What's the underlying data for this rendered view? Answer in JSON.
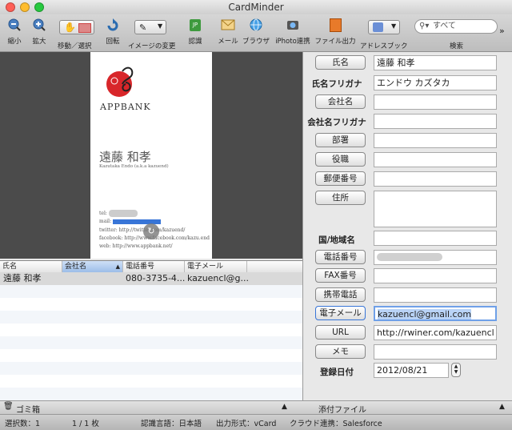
{
  "window": {
    "title": "CardMinder"
  },
  "toolbar": {
    "shrink": "縮小",
    "enlarge": "拡大",
    "move_select": "移動／選択",
    "rotate": "回転",
    "image_change": "イメージの変更",
    "recognize": "認識",
    "mail": "メール",
    "browser": "ブラウザ",
    "iphoto": "iPhoto連携",
    "file_output": "ファイル出力",
    "address_book": "アドレスブック",
    "search_label": "検索",
    "search_placeholder": "すべて"
  },
  "card": {
    "brand": "APPBANK",
    "name": "遠藤 和孝",
    "romaji": "Kazutaka Endo (a.k.a kazuend)",
    "tel_label": "tel:",
    "mail_label": "mail:",
    "twitter": "twitter: http://twitter.com/kazuend/",
    "facebook": "facebook: http://www.facebook.com/kazu.end",
    "web": "web: http://www.appbank.net/"
  },
  "list": {
    "columns": [
      "氏名",
      "会社名",
      "電話番号",
      "電子メール"
    ],
    "rows": [
      {
        "name": "遠藤 和孝",
        "company": "",
        "phone": "080-3735-4...",
        "email": "kazuencl@g..."
      }
    ]
  },
  "bottom": {
    "trash": "ゴミ箱",
    "attachments": "添付ファイル"
  },
  "status": {
    "selection": "選択数：1",
    "page": "1 / 1 枚",
    "language": "認識言語：日本語",
    "output_format": "出力形式：vCard",
    "cloud": "クラウド連携：Salesforce"
  },
  "form": {
    "name_btn": "氏名",
    "name_val": "遠藤 和孝",
    "name_kana_lbl": "氏名フリガナ",
    "name_kana_val": "エンドウ カズタカ",
    "company_btn": "会社名",
    "company_val": "",
    "company_kana_lbl": "会社名フリガナ",
    "company_kana_val": "",
    "dept_btn": "部署",
    "dept_val": "",
    "title_btn": "役職",
    "title_val": "",
    "zip_btn": "郵便番号",
    "zip_val": "",
    "address_btn": "住所",
    "address_val": "",
    "country_lbl": "国/地域名",
    "country_val": "",
    "phone_btn": "電話番号",
    "fax_btn": "FAX番号",
    "fax_val": "",
    "mobile_btn": "携帯電話",
    "mobile_val": "",
    "email_btn": "電子メール",
    "email_val": "kazuencl@gmail.com",
    "url_btn": "URL",
    "url_val": "http://rwiner.com/kazuencl",
    "memo_btn": "メモ",
    "memo_val": "",
    "reg_date_lbl": "登録日付",
    "reg_date_val": "2012/08/21"
  },
  "colors": {
    "selection": "#3875d7",
    "highlight_row": "#d9d9d9",
    "card_bg": "#4b4b4b"
  }
}
